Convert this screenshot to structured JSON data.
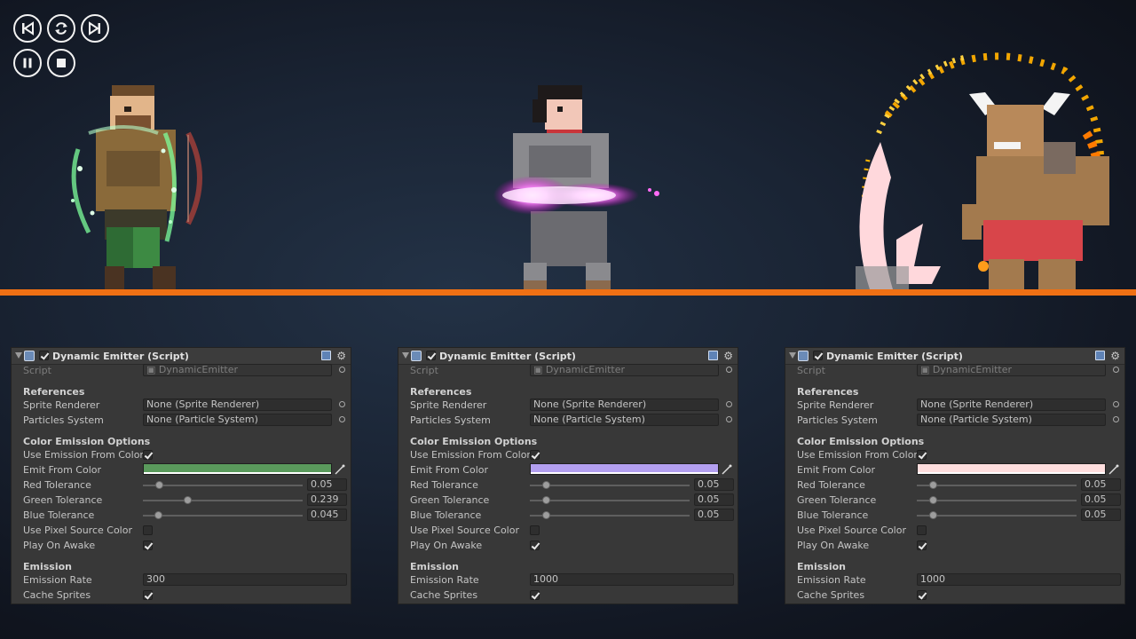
{
  "playback": {
    "buttons": [
      "previous-icon",
      "restart-icon",
      "next-icon",
      "pause-icon",
      "stop-icon"
    ]
  },
  "scene": {
    "ground_color": "#ef7014",
    "characters": [
      "archer",
      "warrior",
      "minotaur"
    ]
  },
  "panels": [
    {
      "title": "Dynamic Emitter (Script)",
      "script_label": "Script",
      "script_value": "DynamicEmitter",
      "references_header": "References",
      "sprite_renderer_label": "Sprite Renderer",
      "sprite_renderer_value": "None (Sprite Renderer)",
      "particles_label": "Particles System",
      "particles_value": "None (Particle System)",
      "color_header": "Color Emission Options",
      "use_emission_label": "Use Emission From Color",
      "use_emission_checked": true,
      "emit_color_label": "Emit From Color",
      "emit_color": "#5a9a5c",
      "red_label": "Red Tolerance",
      "red_value": "0.05",
      "red_fraction": 0.05,
      "green_label": "Green Tolerance",
      "green_value": "0.239",
      "green_fraction": 0.239,
      "blue_label": "Blue Tolerance",
      "blue_value": "0.045",
      "blue_fraction": 0.045,
      "pixel_source_label": "Use Pixel Source Color",
      "pixel_source_checked": false,
      "play_on_awake_label": "Play On Awake",
      "play_on_awake_checked": true,
      "emission_header": "Emission",
      "rate_label": "Emission Rate",
      "rate_value": "300",
      "cache_label": "Cache Sprites",
      "cache_checked": true
    },
    {
      "title": "Dynamic Emitter (Script)",
      "script_label": "Script",
      "script_value": "DynamicEmitter",
      "references_header": "References",
      "sprite_renderer_label": "Sprite Renderer",
      "sprite_renderer_value": "None (Sprite Renderer)",
      "particles_label": "Particles System",
      "particles_value": "None (Particle System)",
      "color_header": "Color Emission Options",
      "use_emission_label": "Use Emission From Color",
      "use_emission_checked": true,
      "emit_color_label": "Emit From Color",
      "emit_color": "#b39ff0",
      "red_label": "Red Tolerance",
      "red_value": "0.05",
      "red_fraction": 0.05,
      "green_label": "Green Tolerance",
      "green_value": "0.05",
      "green_fraction": 0.05,
      "blue_label": "Blue Tolerance",
      "blue_value": "0.05",
      "blue_fraction": 0.05,
      "pixel_source_label": "Use Pixel Source Color",
      "pixel_source_checked": false,
      "play_on_awake_label": "Play On Awake",
      "play_on_awake_checked": true,
      "emission_header": "Emission",
      "rate_label": "Emission Rate",
      "rate_value": "1000",
      "cache_label": "Cache Sprites",
      "cache_checked": true
    },
    {
      "title": "Dynamic Emitter (Script)",
      "script_label": "Script",
      "script_value": "DynamicEmitter",
      "references_header": "References",
      "sprite_renderer_label": "Sprite Renderer",
      "sprite_renderer_value": "None (Sprite Renderer)",
      "particles_label": "Particles System",
      "particles_value": "None (Particle System)",
      "color_header": "Color Emission Options",
      "use_emission_label": "Use Emission From Color",
      "use_emission_checked": true,
      "emit_color_label": "Emit From Color",
      "emit_color": "#ffdede",
      "red_label": "Red Tolerance",
      "red_value": "0.05",
      "red_fraction": 0.05,
      "green_label": "Green Tolerance",
      "green_value": "0.05",
      "green_fraction": 0.05,
      "blue_label": "Blue Tolerance",
      "blue_value": "0.05",
      "blue_fraction": 0.05,
      "pixel_source_label": "Use Pixel Source Color",
      "pixel_source_checked": false,
      "play_on_awake_label": "Play On Awake",
      "play_on_awake_checked": true,
      "emission_header": "Emission",
      "rate_label": "Emission Rate",
      "rate_value": "1000",
      "cache_label": "Cache Sprites",
      "cache_checked": true
    }
  ]
}
